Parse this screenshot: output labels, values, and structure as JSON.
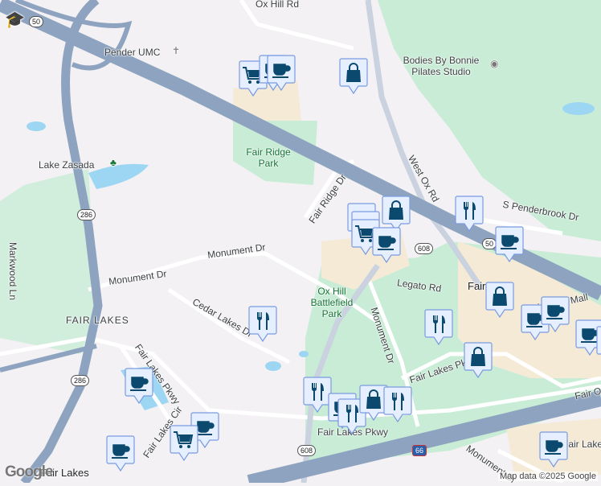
{
  "map": {
    "roads": [
      "Ox Hill Rd",
      "West Ox Rd",
      "S Penderbrook Dr",
      "Fair Ridge Dr",
      "Monument Dr",
      "Monument Dr",
      "Cedar Lakes Dr",
      "Legato Rd",
      "Monument Dr",
      "Fair Lakes Pkwy",
      "Fair Lakes Pkwy",
      "Fair Lakes Cir",
      "Fair Oaks Mall",
      "Fair Oaks",
      "Markwood Ln",
      "Fair Lakes Pkwy",
      "Monument Dr",
      "Fair Lakes Way"
    ],
    "places": {
      "pender": "Pender UMC",
      "bodies": "Bodies By Bonnie Pilates Studio",
      "lake": "Lake Zasada",
      "fairridge": "Fair Ridge Park",
      "oxhill": "Ox Hill Battlefield Park",
      "fairlakes": "FAIR LAKES",
      "fairlakes2": "Fair Lakes",
      "fairoaks": "Fair Oaks"
    },
    "shields": {
      "us50a": "50",
      "us50b": "50",
      "r286a": "286",
      "r286b": "286",
      "r608a": "608",
      "r608b": "608",
      "i66": "66"
    },
    "markers": [
      "shopping-cart",
      "coffee",
      "coffee",
      "shopping-bag",
      "coffee",
      "coffee",
      "shopping-bag",
      "shopping-cart",
      "coffee",
      "restaurant",
      "coffee",
      "shopping-bag",
      "coffee",
      "coffee",
      "coffee",
      "coffee",
      "restaurant",
      "shopping-bag",
      "restaurant",
      "coffee",
      "restaurant",
      "coffee",
      "restaurant",
      "shopping-bag",
      "restaurant",
      "coffee",
      "shopping-cart",
      "coffee",
      "coffee"
    ]
  },
  "attribution": "Map data ©2025 Google",
  "logo": "Google",
  "colors": {
    "highway": "#8ea3bf",
    "park": "#c8ecd6",
    "shopping": "#f5ead6",
    "water": "#9dd6f2",
    "marker": "#0b4a6e",
    "marker_bg": "#e6efff"
  }
}
